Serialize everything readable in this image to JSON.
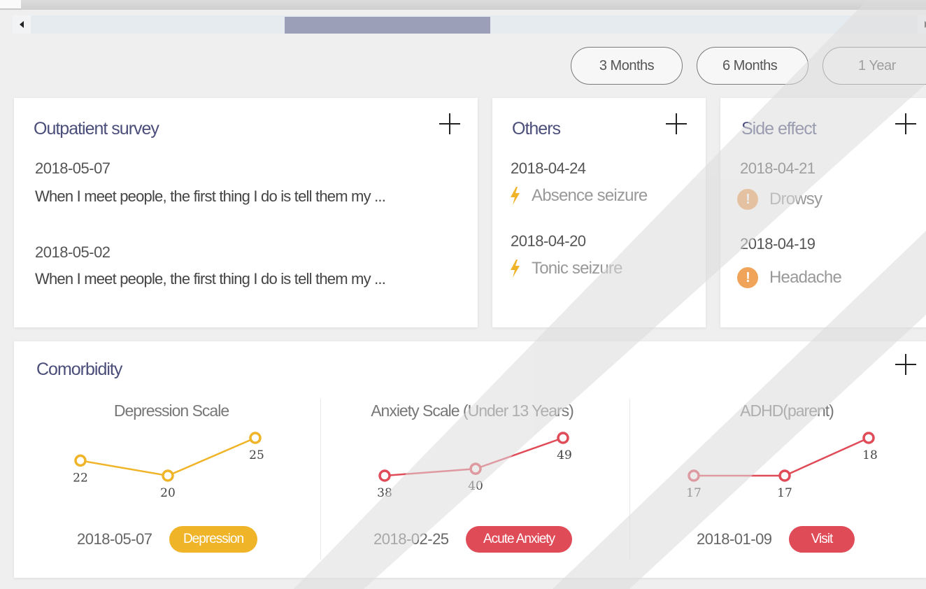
{
  "range_buttons": [
    "3 Months",
    "6 Months",
    "1 Year"
  ],
  "outpatient": {
    "title": "Outpatient survey",
    "entries": [
      {
        "date": "2018-05-07",
        "text": "When I meet people, the first thing I do is tell them my ..."
      },
      {
        "date": "2018-05-02",
        "text": "When I meet people, the first thing I do is tell them my ..."
      }
    ]
  },
  "others": {
    "title": "Others",
    "entries": [
      {
        "date": "2018-04-24",
        "label": "Absence seizure",
        "icon": "lightning-icon"
      },
      {
        "date": "2018-04-20",
        "label": "Tonic seizure",
        "icon": "lightning-icon"
      }
    ]
  },
  "side_effect": {
    "title": "Side effect",
    "entries": [
      {
        "date": "2018-04-21",
        "label": "Drowsy",
        "icon": "warning-icon"
      },
      {
        "date": "2018-04-19",
        "label": "Headache",
        "icon": "warning-icon"
      }
    ]
  },
  "comorbidity": {
    "title": "Comorbidity",
    "charts": [
      {
        "title": "Depression Scale",
        "values": [
          22,
          20,
          25
        ],
        "date": "2018-05-07",
        "tag": "Depression",
        "color": "#f0b429"
      },
      {
        "title": "Anxiety Scale (Under 13 Years)",
        "values": [
          38,
          40,
          49
        ],
        "date": "2018-02-25",
        "tag": "Acute Anxiety",
        "color": "#e04b58"
      },
      {
        "title": "ADHD(parent)",
        "values": [
          17,
          17,
          18
        ],
        "date": "2018-01-09",
        "tag": "Visit",
        "color": "#e04b58"
      }
    ]
  },
  "chart_data": [
    {
      "type": "line",
      "title": "Depression Scale",
      "series": [
        {
          "values": [
            22,
            20,
            25
          ]
        }
      ]
    },
    {
      "type": "line",
      "title": "Anxiety Scale (Under 13 Years)",
      "series": [
        {
          "values": [
            38,
            40,
            49
          ]
        }
      ]
    },
    {
      "type": "line",
      "title": "ADHD(parent)",
      "series": [
        {
          "values": [
            17,
            17,
            18
          ]
        }
      ]
    }
  ]
}
